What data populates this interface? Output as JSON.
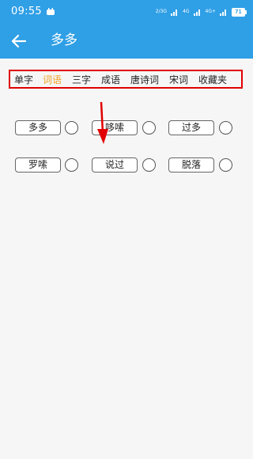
{
  "status_bar": {
    "time": "09:55",
    "signal_a": "2/3G",
    "signal_b": "4G",
    "signal_c": "4G+",
    "battery": "71"
  },
  "header": {
    "title": "多多",
    "back_icon": "arrow-left-icon"
  },
  "tabs": [
    {
      "label": "单字",
      "active": false
    },
    {
      "label": "词语",
      "active": true
    },
    {
      "label": "三字",
      "active": false
    },
    {
      "label": "成语",
      "active": false
    },
    {
      "label": "唐诗词",
      "active": false
    },
    {
      "label": "宋词",
      "active": false
    },
    {
      "label": "收藏夹",
      "active": false
    }
  ],
  "words": [
    {
      "label": "多多",
      "selected": false
    },
    {
      "label": "哆嗦",
      "selected": false
    },
    {
      "label": "过多",
      "selected": false
    },
    {
      "label": "罗嗦",
      "selected": false
    },
    {
      "label": "说过",
      "selected": false
    },
    {
      "label": "脱落",
      "selected": false
    }
  ],
  "colors": {
    "primary": "#2f9fe6",
    "active_tab": "#f0a020",
    "annotation": "#e00000",
    "background": "#f6f6f6"
  }
}
